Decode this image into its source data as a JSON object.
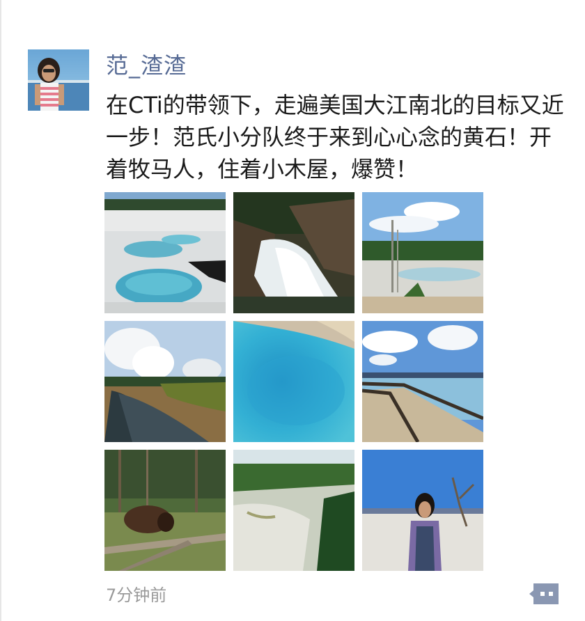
{
  "post": {
    "username": "范_渣渣",
    "text": "在CTi的带领下，走遍美国大江南北的目标又近一步！范氏小分队终于来到心心念的黄石！开着牧马人，住着小木屋，爆赞！",
    "timestamp": "7分钟前",
    "photo_count": 9
  },
  "icons": {
    "comment": "comment-dots-icon"
  },
  "colors": {
    "username": "#576b95",
    "timestamp": "#9a9a9a",
    "comment_button": "#8a97b2"
  }
}
